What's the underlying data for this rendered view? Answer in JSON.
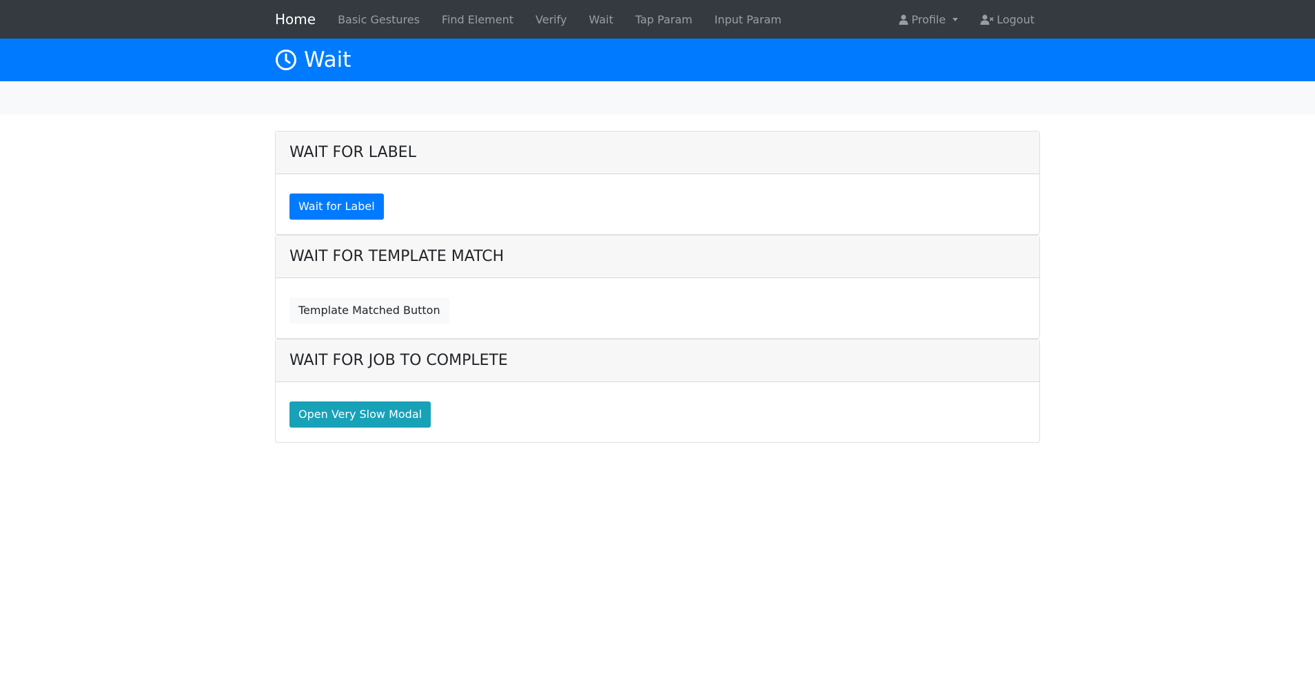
{
  "navbar": {
    "brand": "Home",
    "links": [
      "Basic Gestures",
      "Find Element",
      "Verify",
      "Wait",
      "Tap Param",
      "Input Param"
    ],
    "profile_label": "Profile",
    "logout_label": "Logout",
    "icons": {
      "profile": "user-icon",
      "logout": "user-times-icon"
    }
  },
  "header": {
    "title": "Wait",
    "icon": "clock-icon"
  },
  "cards": [
    {
      "title": "WAIT FOR LABEL",
      "button_label": "Wait for Label"
    },
    {
      "title": "WAIT FOR TEMPLATE MATCH",
      "button_label": "Template Matched Button"
    },
    {
      "title": "WAIT FOR JOB TO COMPLETE",
      "button_label": "Open Very Slow Modal"
    }
  ],
  "colors": {
    "navbar_bg": "#343a40",
    "header_bg": "#007bff",
    "primary": "#007bff",
    "light": "#f8f9fa",
    "info": "#17a2b8"
  }
}
